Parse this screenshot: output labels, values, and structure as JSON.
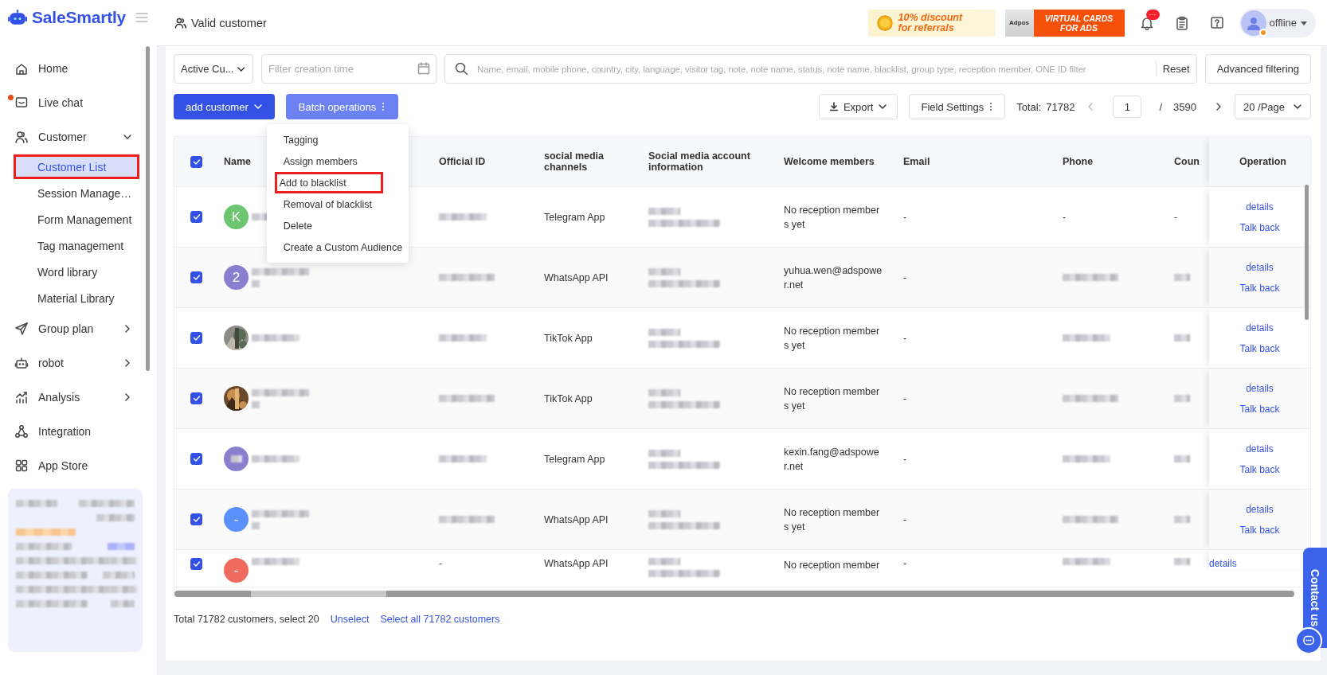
{
  "app": {
    "logo": "SaleSmartly"
  },
  "sidebar": {
    "items": [
      {
        "label": "Home",
        "kind": "link",
        "selected": false,
        "dot": false
      },
      {
        "label": "Live chat",
        "kind": "link",
        "selected": false,
        "dot": true
      },
      {
        "label": "Customer",
        "kind": "group",
        "selected": false,
        "dot": false,
        "expanded": true,
        "children": [
          {
            "label": "Customer List",
            "selected": true,
            "highlighted": true
          },
          {
            "label": "Session Manage…",
            "selected": false,
            "highlighted": false
          },
          {
            "label": "Form Management",
            "selected": false,
            "highlighted": false
          },
          {
            "label": "Tag management",
            "selected": false,
            "highlighted": false
          },
          {
            "label": "Word library",
            "selected": false,
            "highlighted": false
          },
          {
            "label": "Material Library",
            "selected": false,
            "highlighted": false
          }
        ]
      },
      {
        "label": "Group plan",
        "kind": "group",
        "selected": false,
        "dot": false,
        "expanded": false
      },
      {
        "label": "robot",
        "kind": "group",
        "selected": false,
        "dot": false,
        "expanded": false
      },
      {
        "label": "Analysis",
        "kind": "group",
        "selected": false,
        "dot": false,
        "expanded": false
      },
      {
        "label": "Integration",
        "kind": "link",
        "selected": false,
        "dot": false
      },
      {
        "label": "App Store",
        "kind": "link",
        "selected": false,
        "dot": false
      }
    ]
  },
  "header": {
    "title": "Valid customer",
    "promos": [
      {
        "kind": "referral",
        "lines": [
          "10% discount",
          "for referrals"
        ]
      },
      {
        "kind": "cards",
        "brand": "Adpos",
        "lines": [
          "VIRTUAL CARDS",
          "FOR ADS"
        ]
      }
    ],
    "notification_badge": "···",
    "user": {
      "status": "offline"
    }
  },
  "filters": {
    "segment": "Active Cu...",
    "date": {
      "placeholder": "Filter creation time"
    },
    "search": {
      "placeholder": "Name, email, mobile phone, country, city, language, visitor tag, note, note name, status, note name, blacklist, group type, reception member, ONE ID filter"
    },
    "reset": "Reset",
    "advanced": "Advanced filtering"
  },
  "actions": {
    "add": "add customer",
    "batch": {
      "label": "Batch operations",
      "expanded": true,
      "menu": [
        {
          "label": "Tagging",
          "highlighted": false
        },
        {
          "label": "Assign members",
          "highlighted": false
        },
        {
          "label": "Add to blacklist",
          "highlighted": true
        },
        {
          "label": "Removal of blacklist",
          "highlighted": false
        },
        {
          "label": "Delete",
          "highlighted": false
        },
        {
          "label": "Create a Custom Audience",
          "highlighted": false
        }
      ]
    },
    "export": "Export",
    "field_settings": "Field Settings",
    "total_label": "Total:",
    "total": "71782",
    "page": "1",
    "separator": "/",
    "pages": "3590",
    "page_size": "20 /Page"
  },
  "table": {
    "all_checked": true,
    "columns": [
      "Name",
      "Official ID",
      "social media channels",
      "Social media account information",
      "Welcome members",
      "Email",
      "Phone",
      "Coun",
      "Operation"
    ],
    "rows": [
      {
        "checked": true,
        "avatar": {
          "kind": "letter",
          "text": "K",
          "color": "#6cc56f"
        },
        "channel": "Telegram App",
        "welcome": "No reception member s yet",
        "email": "-",
        "phone": "-",
        "country": "-",
        "operations": [
          "details",
          "Talk back"
        ]
      },
      {
        "checked": true,
        "avatar": {
          "kind": "letter",
          "text": "2",
          "color": "#8a7fcf"
        },
        "channel": "WhatsApp API",
        "welcome": "yuhua.wen@adspowe r.net",
        "email": "-",
        "operations": [
          "details",
          "Talk back"
        ]
      },
      {
        "checked": true,
        "channel": "TikTok App",
        "welcome": "No reception member s yet",
        "email": "-",
        "operations": [
          "details",
          "Talk back"
        ]
      },
      {
        "checked": true,
        "channel": "TikTok App",
        "welcome": "No reception member s yet",
        "email": "-",
        "operations": [
          "details",
          "Talk back"
        ]
      },
      {
        "checked": true,
        "avatar": {
          "kind": "blurred",
          "color": "#8a7fcf"
        },
        "channel": "Telegram App",
        "welcome": "kexin.fang@adspowe r.net",
        "email": "-",
        "operations": [
          "details",
          "Talk back"
        ]
      },
      {
        "checked": true,
        "avatar": {
          "kind": "letter",
          "text": "-",
          "color": "#5b8ff9"
        },
        "channel": "WhatsApp API",
        "welcome": "No reception member s yet",
        "email": "-",
        "operations": [
          "details",
          "Talk back"
        ]
      },
      {
        "checked": true,
        "avatar": {
          "kind": "letter",
          "text": "-",
          "color": "#ee6b5e"
        },
        "official_id": "-",
        "channel": "WhatsApp API",
        "welcome": "No reception member",
        "email": "-",
        "operations": [
          "details"
        ]
      }
    ]
  },
  "footer": {
    "summary": "Total 71782 customers, select 20",
    "links": [
      "Unselect",
      "Select all 71782 customers"
    ]
  },
  "contact": {
    "label": "Contact us"
  }
}
